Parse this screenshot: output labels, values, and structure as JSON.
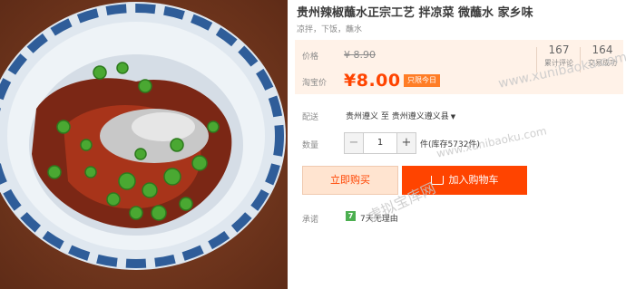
{
  "product": {
    "title": "贵州辣椒蘸水正宗工艺 拌凉菜 微蘸水 家乡味",
    "subtitle": "凉拌，下饭，蘸水"
  },
  "price": {
    "label": "价格",
    "original": "¥ 8.90",
    "promo_label": "淘宝价",
    "current": "¥8.00",
    "badge": "只限今日"
  },
  "stats": [
    {
      "value": "167",
      "caption": "累计评论"
    },
    {
      "value": "164",
      "caption": "交易成功"
    }
  ],
  "shipping": {
    "label": "配送",
    "from": "贵州遵义",
    "to_word": "至",
    "to": "贵州遵义遵义县"
  },
  "quantity": {
    "label": "数量",
    "value": "1",
    "minus": "−",
    "plus": "+",
    "stock_text": "件(库存5732件)"
  },
  "actions": {
    "buy_now": "立即购买",
    "add_to_cart": "加入购物车"
  },
  "promise": {
    "label": "承诺",
    "badge": "7",
    "text": "7天无理由"
  },
  "watermarks": {
    "site": "www.xunibaoku.com",
    "cn": "虚拟宝库网"
  },
  "colors": {
    "accent": "#ff4400",
    "price_bg": "#fff2e8",
    "badge": "#ff7d26",
    "promise_badge": "#4caf50"
  }
}
